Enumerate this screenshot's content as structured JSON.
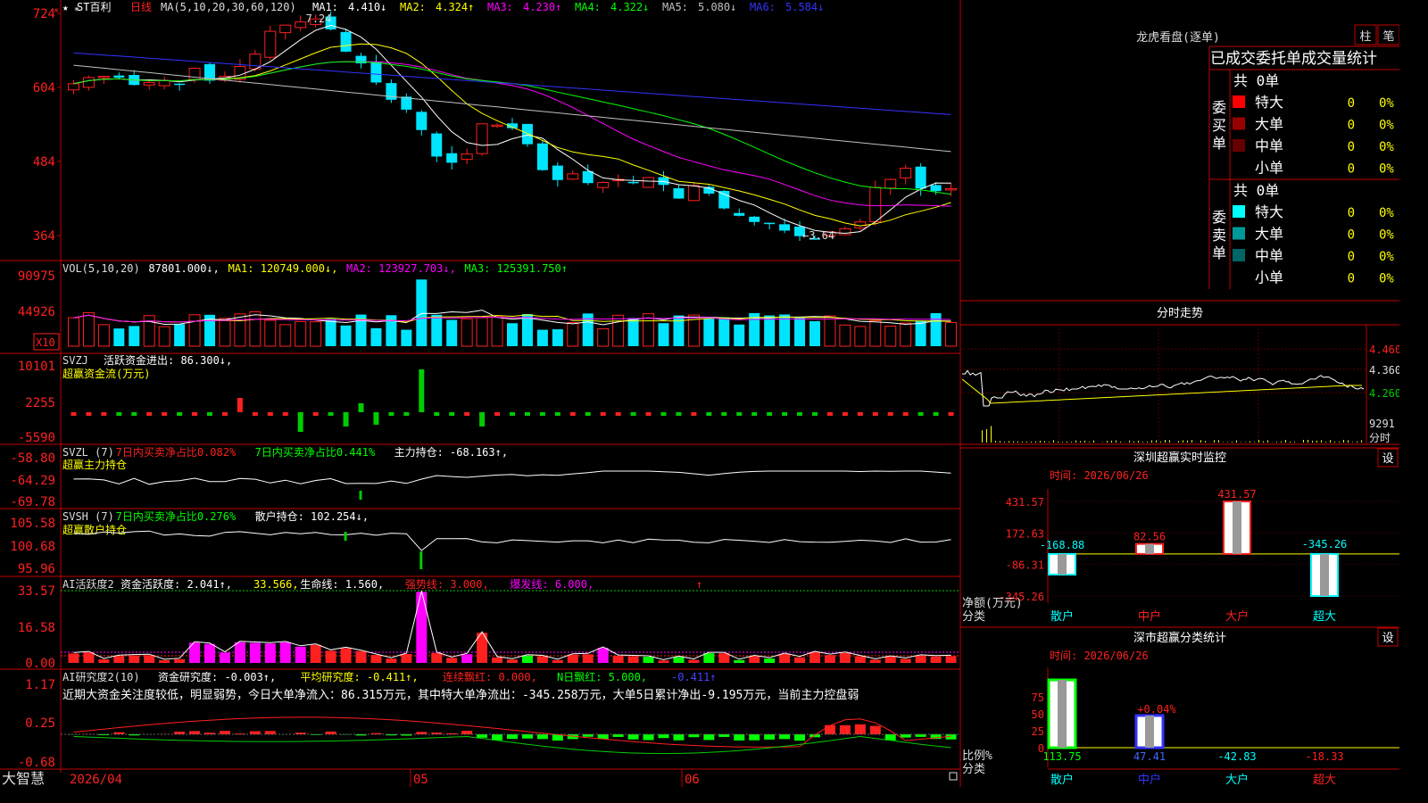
{
  "colors": {
    "up": "#ff2020",
    "down": "#00e5ff",
    "frame": "#c00000",
    "bg": "#000000"
  },
  "price_panel": {
    "header": {
      "stock_name": "ST百利",
      "period": "日线",
      "ma_spec": "MA(5,10,20,30,60,120)",
      "ma_values": [
        {
          "label": "MA1:",
          "value": "4.410↓",
          "color": "#ffffff"
        },
        {
          "label": "MA2:",
          "value": "4.324↑",
          "color": "#ffff00"
        },
        {
          "label": "MA3:",
          "value": "4.230↑",
          "color": "#ff00ff"
        },
        {
          "label": "MA4:",
          "value": "4.322↓",
          "color": "#00ff00"
        },
        {
          "label": "MA5:",
          "value": "5.080↓",
          "color": "#c0c0c0"
        },
        {
          "label": "MA6:",
          "value": "5.584↓",
          "color": "#3333ff"
        }
      ]
    },
    "axis_labels": [
      "724",
      "604",
      "484",
      "364"
    ],
    "high_mark": "7.24",
    "low_mark": "3.64"
  },
  "vol_panel": {
    "header": [
      {
        "text": "VOL(5,10,20)",
        "color": "#dddddd"
      },
      {
        "text": "87801.000↓,",
        "color": "#ffffff"
      },
      {
        "text": "MA1: 120749.000↓,",
        "color": "#ffff00"
      },
      {
        "text": "MA2: 123927.703↓,",
        "color": "#ff00ff"
      },
      {
        "text": "MA3: 125391.750↑",
        "color": "#00ff00"
      }
    ],
    "axis_labels": [
      "90975",
      "44926"
    ],
    "unit": "X10"
  },
  "svzj_panel": {
    "title": "SVZJ",
    "line1": "活跃资金进出: 86.300↓,",
    "line2": "超赢资金流(万元)",
    "axis_labels": [
      "10101",
      "2255",
      "-5590"
    ]
  },
  "svzl_panel": {
    "header": [
      {
        "text": "SVZL (7)",
        "color": "#dddddd"
      },
      {
        "text": "7日内买卖净占比0.082%",
        "color": "#ff2020"
      },
      {
        "text": "7日内买卖净占比0.441%",
        "color": "#00ff00"
      },
      {
        "text": "主力持仓: -68.163↑,",
        "color": "#ffffff"
      }
    ],
    "sub": "超赢主力持仓",
    "axis_labels": [
      "-58.80",
      "-64.29",
      "-69.78"
    ]
  },
  "svsh_panel": {
    "header": [
      {
        "text": "SVSH (7)",
        "color": "#dddddd"
      },
      {
        "text": "7日内买卖净占比0.276%",
        "color": "#00ff00"
      },
      {
        "text": "散户持仓: 102.254↓,",
        "color": "#ffffff"
      }
    ],
    "sub": "超赢散户持仓",
    "axis_labels": [
      "105.58",
      "100.68",
      "95.96"
    ]
  },
  "ai1_panel": {
    "header": [
      {
        "text": "AI活跃度2",
        "color": "#dddddd"
      },
      {
        "text": "资金活跃度: 2.041↑,",
        "color": "#ffffff"
      },
      {
        "text": "33.566,",
        "color": "#ffff00"
      },
      {
        "text": "生命线: 1.560,",
        "color": "#ffffff"
      },
      {
        "text": "强势线: 3.000,",
        "color": "#ff2020"
      },
      {
        "text": "爆发线: 6.000,",
        "color": "#ff00ff"
      }
    ],
    "axis_labels": [
      "33.57",
      "16.58",
      "0.00"
    ]
  },
  "ai2_panel": {
    "header": [
      {
        "text": "AI研究度2(10)",
        "color": "#dddddd"
      },
      {
        "text": "资金研究度: -0.003↑,",
        "color": "#ffffff"
      },
      {
        "text": "平均研究度: -0.411↑,",
        "color": "#ffff00"
      },
      {
        "text": "连续飘红: 0.000,",
        "color": "#ff2020"
      },
      {
        "text": "N日飘红: 5.000,",
        "color": "#00ff00"
      },
      {
        "text": "-0.411↑",
        "color": "#4444ff"
      }
    ],
    "comment": "近期大资金关注度较低，明显弱势，今日大单净流入：86.315万元，其中特大单净流出：-345.258万元，大单5日累计净出-9.195万元，当前主力控盘弱",
    "axis_labels": [
      "1.17",
      "0.25",
      "-0.68"
    ]
  },
  "bottom_bar": {
    "brand": "大智慧",
    "date_left": "2026/04",
    "m05": "05",
    "m06": "06"
  },
  "right_panel": {
    "title": "龙虎看盘(逐单)",
    "btn_a": "柱",
    "btn_b": "笔",
    "table_header": "已成交委托单成交量统计",
    "buy": {
      "side_label": "委买单",
      "total": "共 0单",
      "rows": [
        {
          "name": "特大",
          "count": "0",
          "pct": "0%",
          "color": "#ff0000"
        },
        {
          "name": "大单",
          "count": "0",
          "pct": "0%",
          "color": "#990000"
        },
        {
          "name": "中单",
          "count": "0",
          "pct": "0%",
          "color": "#660000"
        },
        {
          "name": "小单",
          "count": "0",
          "pct": "0%",
          "color": ""
        }
      ]
    },
    "sell": {
      "side_label": "委卖单",
      "total": "共 0单",
      "rows": [
        {
          "name": "特大",
          "count": "0",
          "pct": "0%",
          "color": "#00ffff"
        },
        {
          "name": "大单",
          "count": "0",
          "pct": "0%",
          "color": "#009999"
        },
        {
          "name": "中单",
          "count": "0",
          "pct": "0%",
          "color": "#006666"
        },
        {
          "name": "小单",
          "count": "0",
          "pct": "0%",
          "color": ""
        }
      ]
    },
    "intraday": {
      "title": "分时走势",
      "axis": [
        "4.460",
        "4.360",
        "4.260"
      ],
      "vol_label": "9291",
      "unit": "分时"
    },
    "monitor": {
      "title": "深圳超赢实时监控",
      "set_btn": "设",
      "time": "时间: 2026/06/26",
      "axis": [
        "431.57",
        "172.63",
        "-86.31",
        "-345.26"
      ],
      "ylabel": "净额(万元)",
      "xlabel": "分类"
    },
    "stats": {
      "title": "深市超赢分类统计",
      "set_btn": "设",
      "time": "时间: 2026/06/26",
      "axis": [
        "75",
        "50",
        "25",
        "0"
      ],
      "ylabel": "比例%",
      "xlabel": "分类"
    }
  },
  "chart_data": [
    {
      "id": "net_flow",
      "type": "bar",
      "title": "深圳超赢实时监控",
      "ylabel": "净额(万元)",
      "xlabel": "分类",
      "categories": [
        "散户",
        "中户",
        "大户",
        "超大"
      ],
      "values": [
        -168.88,
        82.56,
        431.57,
        -345.26
      ],
      "labels": [
        "-168.88",
        "82.56",
        "431.57",
        "-345.26"
      ],
      "ylim": [
        -345.26,
        431.57
      ]
    },
    {
      "id": "ratio",
      "type": "bar",
      "title": "深市超赢分类统计",
      "ylabel": "比例%",
      "xlabel": "分类",
      "categories": [
        "散户",
        "中户",
        "大户",
        "超大"
      ],
      "values": [
        113.75,
        47.41,
        -42.83,
        -18.33
      ],
      "labels": [
        "113.75",
        "47.41",
        "-42.83",
        "-18.33"
      ],
      "extra_label": "+0.04%",
      "ylim": [
        0,
        100
      ]
    }
  ]
}
